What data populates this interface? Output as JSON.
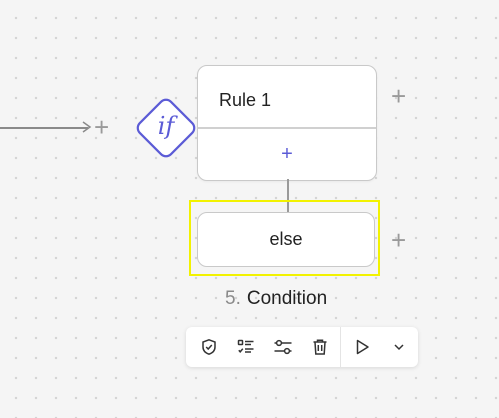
{
  "canvas": {
    "background": "#f5f5f5",
    "accent": "#5b5bd6",
    "highlight_color": "#f2f200"
  },
  "if_node": {
    "label": "if",
    "border_color": "#5b5bd6"
  },
  "rule_card": {
    "label": "Rule 1",
    "add_label": "+"
  },
  "else_card": {
    "label": "else"
  },
  "add_buttons": {
    "glyph": "+"
  },
  "node": {
    "number": "5.",
    "name": "Condition"
  },
  "toolbar": {
    "items": [
      {
        "icon": "shield-check-icon"
      },
      {
        "icon": "checklist-icon"
      },
      {
        "icon": "sliders-icon"
      },
      {
        "icon": "trash-icon"
      },
      {
        "icon": "play-icon"
      },
      {
        "icon": "chevron-down-icon"
      }
    ]
  }
}
